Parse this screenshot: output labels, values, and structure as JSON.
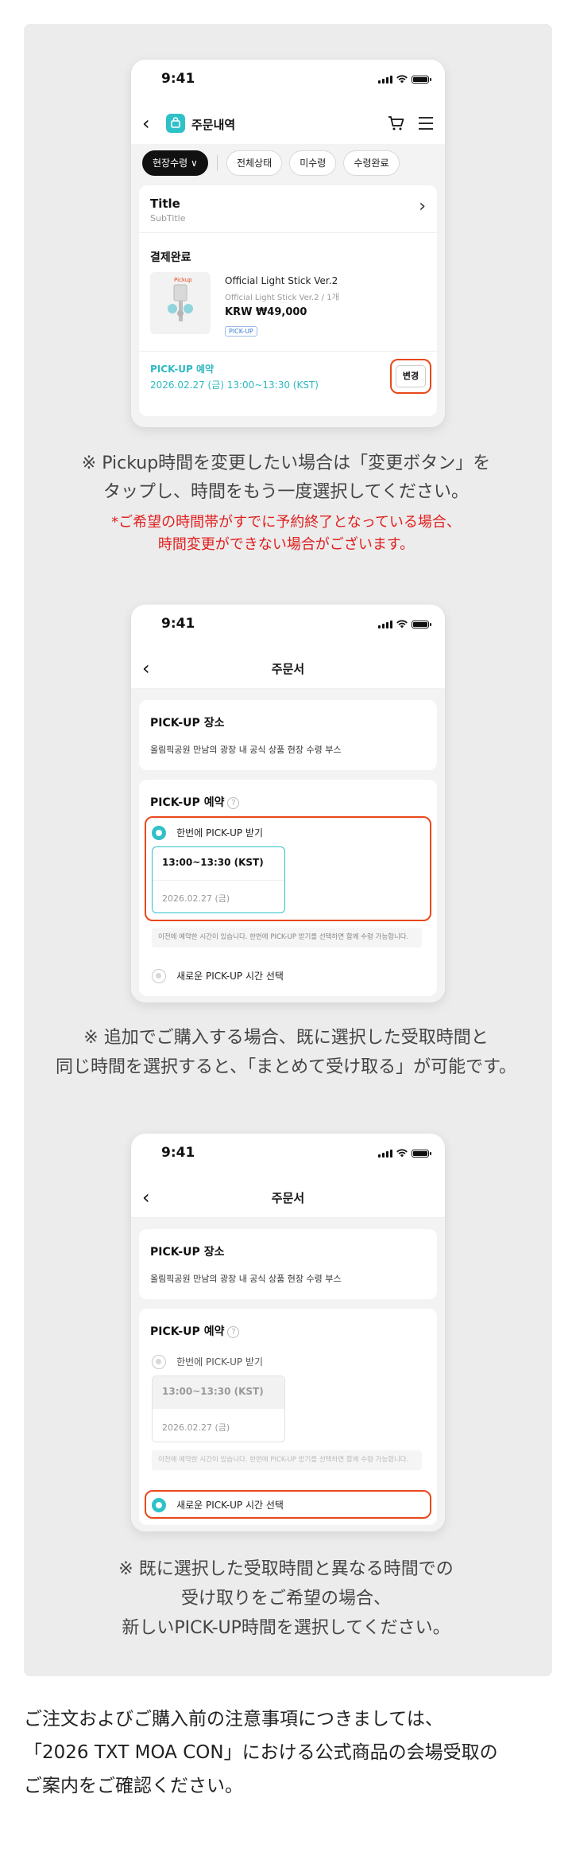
{
  "status_time": "9:41",
  "phone1": {
    "nav_title": "주문내역",
    "filters": [
      "현장수령 ∨",
      "전체상태",
      "미수령",
      "수령완료"
    ],
    "order": {
      "title": "Title",
      "subtitle": "SubTitle",
      "status": "결제완료",
      "product_name": "Official Light Stick Ver.2",
      "product_option": "Official Light Stick Ver.2 / 1개",
      "price": "KRW ₩49,000",
      "badge": "PICK-UP",
      "product_image_label": "Pickup",
      "pickup_label": "PICK-UP 예약",
      "pickup_time": "2026.02.27 (금) 13:00~13:30 (KST)",
      "change_button": "변경"
    }
  },
  "caption1": {
    "line1": "※ Pickup時間を変更したい場合は「変更ボタン」を",
    "line2": "タップし、時間をもう一度選択してください。",
    "note1": "*ご希望の時間帯がすでに予約終了となっている場合、",
    "note2": "時間変更ができない場合がございます。"
  },
  "phone2": {
    "nav_title": "주문서",
    "place_title": "PICK-UP 장소",
    "place_desc": "올림픽공원 만남의 광장 내 공식 상품 현장 수령 부스",
    "reserve_title": "PICK-UP 예약",
    "help_icon": "?",
    "option1": "한번에 PICK-UP 받기",
    "slot_time": "13:00~13:30 (KST)",
    "slot_date": "2026.02.27 (금)",
    "info": "이전에 예약한 시간이 있습니다. 한번에 PICK-UP 받기를 선택하면 함께 수령 가능합니다.",
    "option2": "새로운 PICK-UP 시간 선택"
  },
  "caption2": {
    "line1": "※ 追加でご購入する場合、既に選択した受取時間と",
    "line2": "同じ時間を選択すると、「まとめて受け取る」が可能です。"
  },
  "phone3": {
    "nav_title": "주문서",
    "place_title": "PICK-UP 장소",
    "place_desc": "올림픽공원 만남의 광장 내 공식 상품 현장 수령 부스",
    "reserve_title": "PICK-UP 예약",
    "help_icon": "?",
    "option1": "한번에 PICK-UP 받기",
    "slot_time": "13:00~13:30 (KST)",
    "slot_date": "2026.02.27 (금)",
    "info": "이전에 예약한 시간이 있습니다. 한번에 PICK-UP 받기를 선택하면 함께 수령 가능합니다.",
    "option2": "새로운 PICK-UP 시간 선택"
  },
  "caption3": {
    "line1": "※ 既に選択した受取時間と異なる時間での",
    "line2": "受け取りをご希望の場合、",
    "line3": "新しいPICK-UP時間を選択してください。"
  },
  "footer": {
    "line1": "ご注文およびご購入前の注意事項につきましては、",
    "line2": "「2026 TXT MOA CON」における公式商品の会場受取の",
    "line3": "ご案内をご確認ください。"
  },
  "colors": {
    "accent": "#2fc1c8",
    "highlight": "#e8481b",
    "note_red": "#e02020",
    "panel": "#ececec"
  }
}
